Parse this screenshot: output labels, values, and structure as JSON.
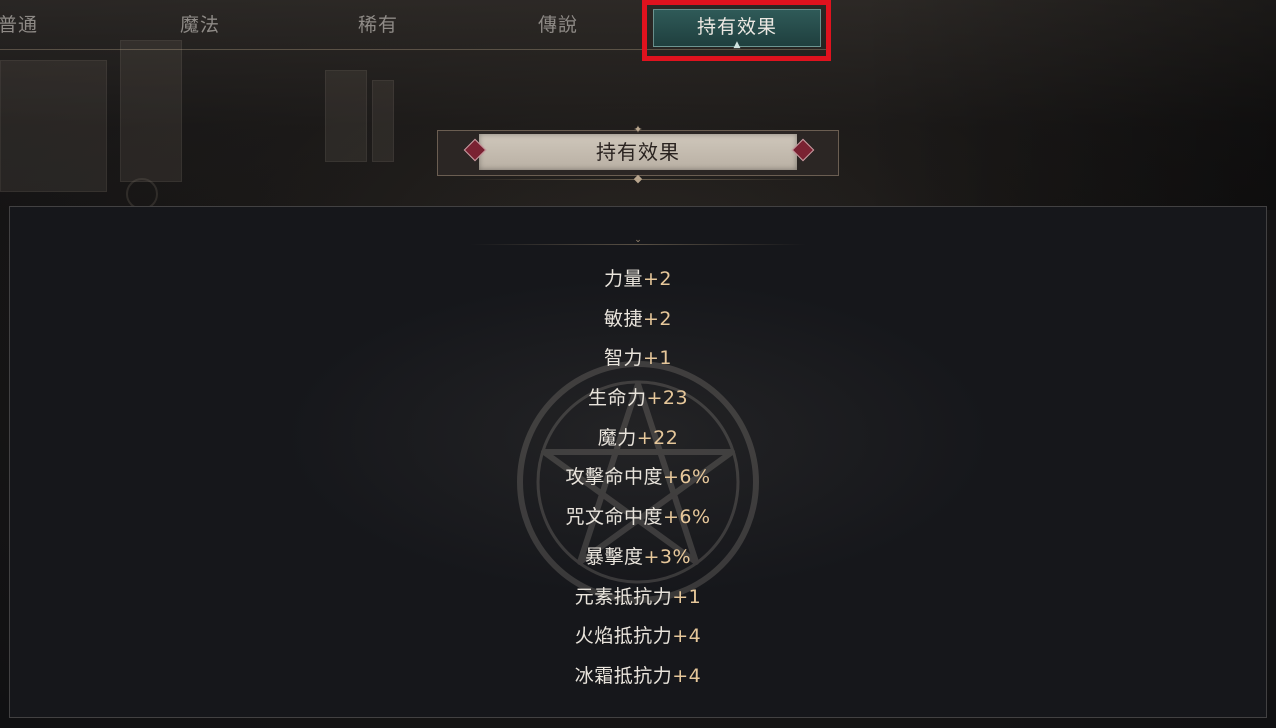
{
  "tabs": [
    {
      "label": "普通",
      "active": false
    },
    {
      "label": "魔法",
      "active": false
    },
    {
      "label": "稀有",
      "active": false
    },
    {
      "label": "傳說",
      "active": false
    },
    {
      "label": "持有效果",
      "active": true
    }
  ],
  "highlight_color": "#e0121e",
  "section": {
    "title": "持有效果"
  },
  "stats": [
    {
      "name": "力量",
      "value": "+2"
    },
    {
      "name": "敏捷",
      "value": "+2"
    },
    {
      "name": "智力",
      "value": "+1"
    },
    {
      "name": "生命力",
      "value": "+23"
    },
    {
      "name": "魔力",
      "value": "+22"
    },
    {
      "name": "攻擊命中度",
      "value": "+6%"
    },
    {
      "name": "咒文命中度",
      "value": "+6%"
    },
    {
      "name": "暴擊度",
      "value": "+3%"
    },
    {
      "name": "元素抵抗力",
      "value": "+1"
    },
    {
      "name": "火焰抵抗力",
      "value": "+4"
    },
    {
      "name": "冰霜抵抗力",
      "value": "+4"
    }
  ],
  "icons": {
    "emblem": "pentagram-emblem-icon",
    "banner_gem": "diamond-gem-icon"
  }
}
